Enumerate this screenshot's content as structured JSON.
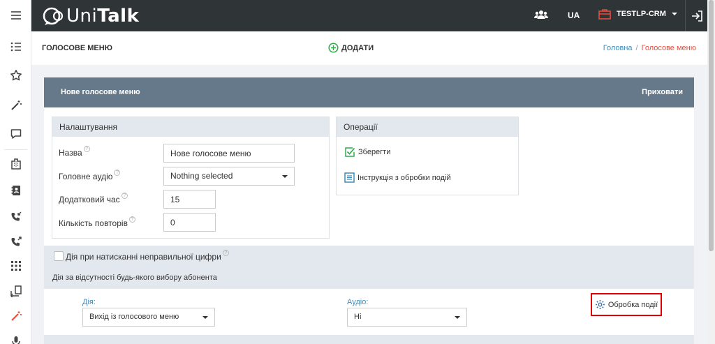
{
  "topbar": {
    "logo_prefix": "Uni",
    "logo_bold": "Talk",
    "lang": "UA",
    "company": "TESTLP-CRM"
  },
  "header": {
    "title": "ГОЛОСОВЕ МЕНЮ",
    "add_label": "ДОДАТИ",
    "breadcrumb_home": "Головна",
    "breadcrumb_sep": "/",
    "breadcrumb_current": "Голосове меню"
  },
  "panel": {
    "title": "Нове голосове меню",
    "hide_label": "Приховати"
  },
  "settings": {
    "heading": "Налаштування",
    "name_label": "Назва",
    "name_value": "Нове голосове меню",
    "audio_label": "Головне аудіо",
    "audio_value": "Nothing selected",
    "extra_time_label": "Додатковий час",
    "extra_time_value": "15",
    "repeats_label": "Кількість повторів",
    "repeats_value": "0"
  },
  "operations": {
    "heading": "Операції",
    "save_label": "Зберегти",
    "instruction_label": "Інструкція з обробки подій"
  },
  "wrong_digit": {
    "label": "Дія при натисканні неправильної цифри"
  },
  "no_choice": {
    "heading": "Дія за відсутності будь-якого вибору абонента",
    "action_label": "Дія:",
    "action_value": "Вихід із голосового меню",
    "audio_label": "Аудіо:",
    "audio_value": "Ні",
    "event_button_label": "Обробка події"
  },
  "colors": {
    "topbar": "#2f3437",
    "panel_header": "#66798b",
    "strip": "#e3e8ee",
    "accent_red": "#e74c3c",
    "highlight_red": "#e00000",
    "link_blue": "#3c8dbc",
    "green": "#2eaa4a"
  },
  "icons": {
    "sidebar": [
      "menu-icon",
      "list-icon",
      "star-icon",
      "magic-wand-icon",
      "chat-icon",
      "building-icon",
      "contacts-icon",
      "incoming-call-icon",
      "outgoing-call-icon",
      "grid-icon",
      "import-icon",
      "magic-wand-red-icon",
      "microphone-icon"
    ]
  }
}
